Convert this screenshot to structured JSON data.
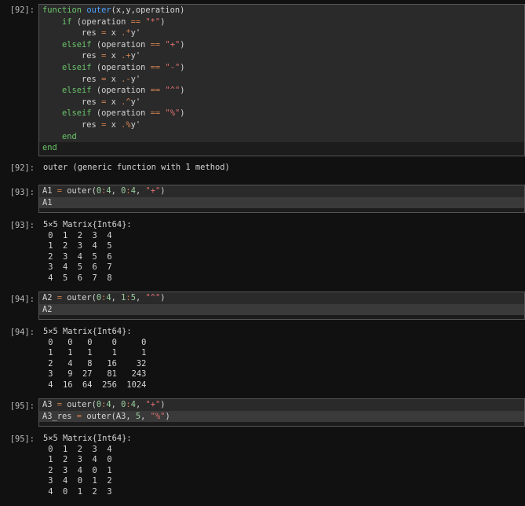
{
  "cells": [
    {
      "in_prompt": "[92]:",
      "code": [
        [
          [
            "kw",
            "function"
          ],
          [
            "t",
            " "
          ],
          [
            "fn",
            "outer"
          ],
          [
            "t",
            "(x,y,operation)"
          ]
        ],
        [
          [
            "t",
            "    "
          ],
          [
            "kw",
            "if"
          ],
          [
            "t",
            " (operation "
          ],
          [
            "op",
            "=="
          ],
          [
            "t",
            " "
          ],
          [
            "str",
            "\"*\""
          ],
          [
            "t",
            ")"
          ]
        ],
        [
          [
            "t",
            "        res "
          ],
          [
            "op",
            "="
          ],
          [
            "t",
            " x "
          ],
          [
            "op",
            ".*"
          ],
          [
            "t",
            "y'"
          ]
        ],
        [
          [
            "t",
            "    "
          ],
          [
            "kw",
            "elseif"
          ],
          [
            "t",
            " (operation "
          ],
          [
            "op",
            "=="
          ],
          [
            "t",
            " "
          ],
          [
            "str",
            "\"+\""
          ],
          [
            "t",
            ")"
          ]
        ],
        [
          [
            "t",
            "        res "
          ],
          [
            "op",
            "="
          ],
          [
            "t",
            " x "
          ],
          [
            "op",
            ".+"
          ],
          [
            "t",
            "y'"
          ]
        ],
        [
          [
            "t",
            "    "
          ],
          [
            "kw",
            "elseif"
          ],
          [
            "t",
            " (operation "
          ],
          [
            "op",
            "=="
          ],
          [
            "t",
            " "
          ],
          [
            "str",
            "\"-\""
          ],
          [
            "t",
            ")"
          ]
        ],
        [
          [
            "t",
            "        res "
          ],
          [
            "op",
            "="
          ],
          [
            "t",
            " x "
          ],
          [
            "op",
            ".-"
          ],
          [
            "t",
            "y'"
          ]
        ],
        [
          [
            "t",
            "    "
          ],
          [
            "kw",
            "elseif"
          ],
          [
            "t",
            " (operation "
          ],
          [
            "op",
            "=="
          ],
          [
            "t",
            " "
          ],
          [
            "str",
            "\"^\""
          ],
          [
            "t",
            ")"
          ]
        ],
        [
          [
            "t",
            "        res "
          ],
          [
            "op",
            "="
          ],
          [
            "t",
            " x "
          ],
          [
            "op",
            ".^"
          ],
          [
            "t",
            "y'"
          ]
        ],
        [
          [
            "t",
            "    "
          ],
          [
            "kw",
            "elseif"
          ],
          [
            "t",
            " (operation "
          ],
          [
            "op",
            "=="
          ],
          [
            "t",
            " "
          ],
          [
            "str",
            "\"%\""
          ],
          [
            "t",
            ")"
          ]
        ],
        [
          [
            "t",
            "        res "
          ],
          [
            "op",
            "="
          ],
          [
            "t",
            " x "
          ],
          [
            "op",
            ".%"
          ],
          [
            "t",
            "y'"
          ]
        ],
        [
          [
            "t",
            "    "
          ],
          [
            "kw",
            "end"
          ]
        ],
        [
          [
            "kw",
            "end"
          ]
        ]
      ],
      "out_prompt": "[92]:",
      "output": [
        "outer (generic function with 1 method)"
      ]
    },
    {
      "in_prompt": "[93]:",
      "code": [
        [
          [
            "t",
            "A1 "
          ],
          [
            "op",
            "="
          ],
          [
            "t",
            " outer("
          ],
          [
            "num",
            "0"
          ],
          [
            "op",
            ":"
          ],
          [
            "num",
            "4"
          ],
          [
            "t",
            ", "
          ],
          [
            "num",
            "0"
          ],
          [
            "op",
            ":"
          ],
          [
            "num",
            "4"
          ],
          [
            "t",
            ", "
          ],
          [
            "str",
            "\"+\""
          ],
          [
            "t",
            ")"
          ]
        ],
        [
          [
            "t",
            "A1"
          ]
        ]
      ],
      "out_prompt": "[93]:",
      "output": [
        "5×5 Matrix{Int64}:",
        " 0  1  2  3  4",
        " 1  2  3  4  5",
        " 2  3  4  5  6",
        " 3  4  5  6  7",
        " 4  5  6  7  8"
      ]
    },
    {
      "in_prompt": "[94]:",
      "code": [
        [
          [
            "t",
            "A2 "
          ],
          [
            "op",
            "="
          ],
          [
            "t",
            " outer("
          ],
          [
            "num",
            "0"
          ],
          [
            "op",
            ":"
          ],
          [
            "num",
            "4"
          ],
          [
            "t",
            ", "
          ],
          [
            "num",
            "1"
          ],
          [
            "op",
            ":"
          ],
          [
            "num",
            "5"
          ],
          [
            "t",
            ", "
          ],
          [
            "str",
            "\"^\""
          ],
          [
            "t",
            ")"
          ]
        ],
        [
          [
            "t",
            "A2"
          ]
        ]
      ],
      "out_prompt": "[94]:",
      "output": [
        "5×5 Matrix{Int64}:",
        " 0   0   0    0     0",
        " 1   1   1    1     1",
        " 2   4   8   16    32",
        " 3   9  27   81   243",
        " 4  16  64  256  1024"
      ]
    },
    {
      "in_prompt": "[95]:",
      "code": [
        [
          [
            "t",
            "A3 "
          ],
          [
            "op",
            "="
          ],
          [
            "t",
            " outer("
          ],
          [
            "num",
            "0"
          ],
          [
            "op",
            ":"
          ],
          [
            "num",
            "4"
          ],
          [
            "t",
            ", "
          ],
          [
            "num",
            "0"
          ],
          [
            "op",
            ":"
          ],
          [
            "num",
            "4"
          ],
          [
            "t",
            ", "
          ],
          [
            "str",
            "\"+\""
          ],
          [
            "t",
            ")"
          ]
        ],
        [
          [
            "t",
            "A3_res "
          ],
          [
            "op",
            "="
          ],
          [
            "t",
            " outer(A3, "
          ],
          [
            "num",
            "5"
          ],
          [
            "t",
            ", "
          ],
          [
            "str",
            "\"%\""
          ],
          [
            "t",
            ")"
          ]
        ]
      ],
      "out_prompt": "[95]:",
      "output": [
        "5×5 Matrix{Int64}:",
        " 0  1  2  3  4",
        " 1  2  3  4  0",
        " 2  3  4  0  1",
        " 3  4  0  1  2",
        " 4  0  1  2  3"
      ]
    }
  ]
}
